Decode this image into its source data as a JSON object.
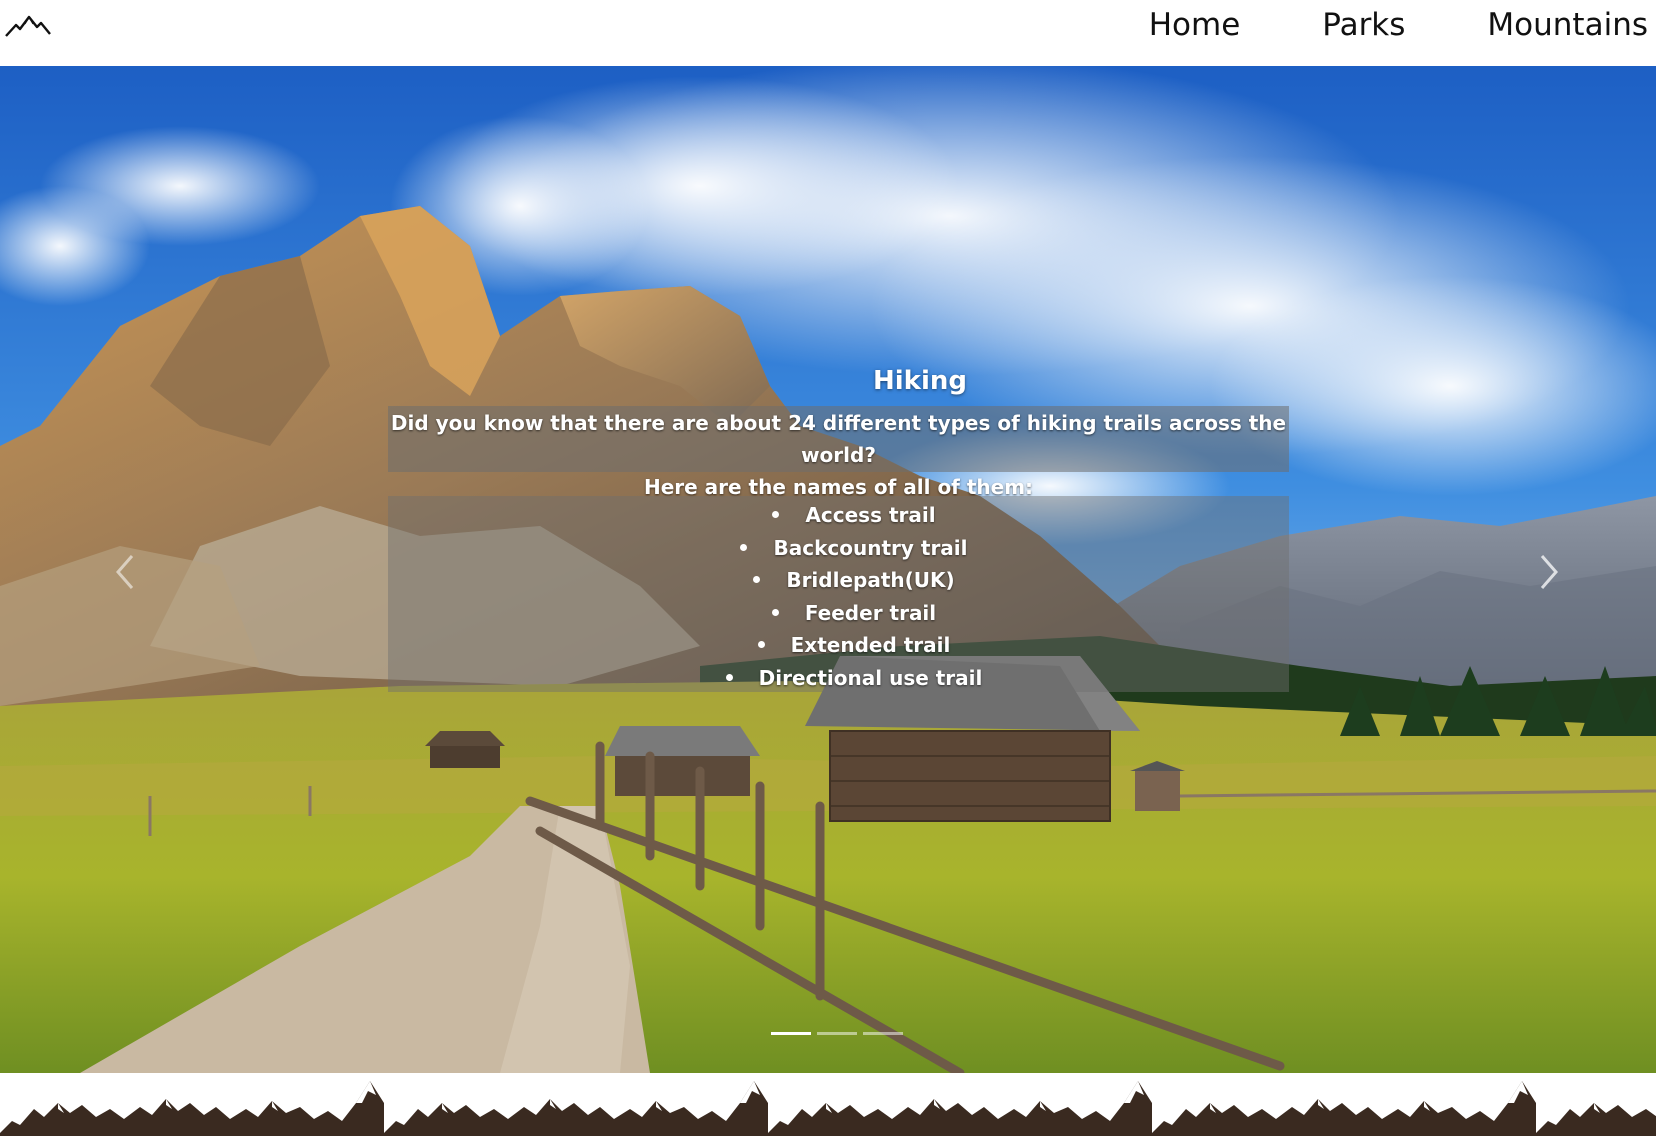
{
  "nav": {
    "logo_icon": "mountain-logo-icon",
    "links": [
      "Home",
      "Parks",
      "Mountains"
    ]
  },
  "carousel": {
    "title": "Hiking",
    "intro_line1": "Did you know that there are about 24 different types of hiking trails across the world?",
    "intro_line2": "Here are the names of all of them:",
    "trails": [
      "Access trail",
      "Backcountry trail",
      "Bridlepath(UK)",
      "Feeder trail",
      "Extended trail",
      "Directional use trail"
    ],
    "prev_icon": "chevron-left-icon",
    "next_icon": "chevron-right-icon",
    "indicator_count": 3,
    "active_indicator": 1
  },
  "footer": {
    "border_icon": "mountain-range-icon",
    "color": "#3a2a20"
  }
}
